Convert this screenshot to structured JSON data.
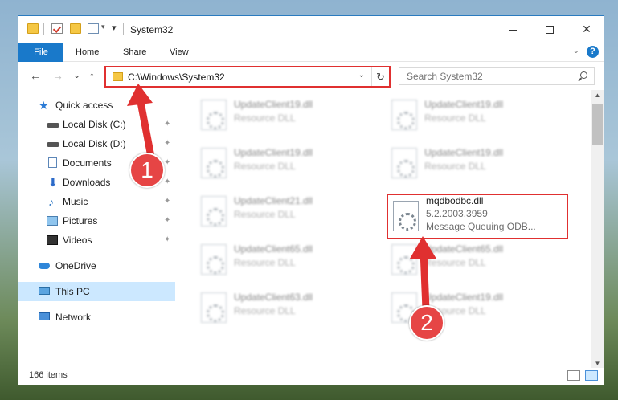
{
  "window": {
    "title": "System32",
    "controls": {
      "minimize_icon": "minimize-icon",
      "maximize_icon": "maximize-icon",
      "close_glyph": "✕"
    }
  },
  "ribbon": {
    "tabs": [
      "File",
      "Home",
      "Share",
      "View"
    ],
    "help_glyph": "?"
  },
  "address_bar": {
    "path": "C:\\Windows\\System32",
    "refresh_glyph": "↻"
  },
  "search": {
    "placeholder": "Search System32"
  },
  "nav_buttons": {
    "back": "←",
    "forward": "→",
    "recent": "⌄",
    "up": "↑"
  },
  "nav_pane": {
    "items": [
      {
        "label": "Quick access",
        "icon": "star-icon"
      },
      {
        "label": "Local Disk (C:)",
        "icon": "drive-icon",
        "pinned": true
      },
      {
        "label": "Local Disk (D:)",
        "icon": "drive-icon",
        "pinned": true
      },
      {
        "label": "Documents",
        "icon": "documents-icon",
        "pinned": true
      },
      {
        "label": "Downloads",
        "icon": "download-icon",
        "pinned": true
      },
      {
        "label": "Music",
        "icon": "music-icon",
        "pinned": true
      },
      {
        "label": "Pictures",
        "icon": "pictures-icon",
        "pinned": true
      },
      {
        "label": "Videos",
        "icon": "videos-icon",
        "pinned": true
      },
      {
        "label": "OneDrive",
        "icon": "onedrive-icon"
      },
      {
        "label": "This PC",
        "icon": "this-pc-icon",
        "selected": true
      },
      {
        "label": "Network",
        "icon": "network-icon"
      }
    ],
    "pin_glyph": "📌"
  },
  "files": [
    {
      "name": "UpdateClient19.dll",
      "type": "Resource DLL"
    },
    {
      "name": "UpdateClient19.dll",
      "type": "Resource DLL"
    },
    {
      "name": "UpdateClient19.dll",
      "type": "Resource DLL"
    },
    {
      "name": "UpdateClient19.dll",
      "type": "Resource DLL"
    },
    {
      "name": "UpdateClient21.dll",
      "type": "Resource DLL"
    },
    {
      "name": "mqdbodbc.dll",
      "version": "5.2.2003.3959",
      "description": "Message Queuing ODB..."
    },
    {
      "name": "UpdateClient65.dll",
      "type": "Resource DLL"
    },
    {
      "name": "UpdateClient65.dll",
      "type": "Resource DLL"
    },
    {
      "name": "UpdateClient63.dll",
      "type": "Resource DLL"
    },
    {
      "name": "UpdateClient19.dll",
      "type": "Resource DLL"
    }
  ],
  "status": {
    "item_count": "166 items"
  },
  "annotations": {
    "step1": "1",
    "step2": "2",
    "color": "#e03030"
  }
}
